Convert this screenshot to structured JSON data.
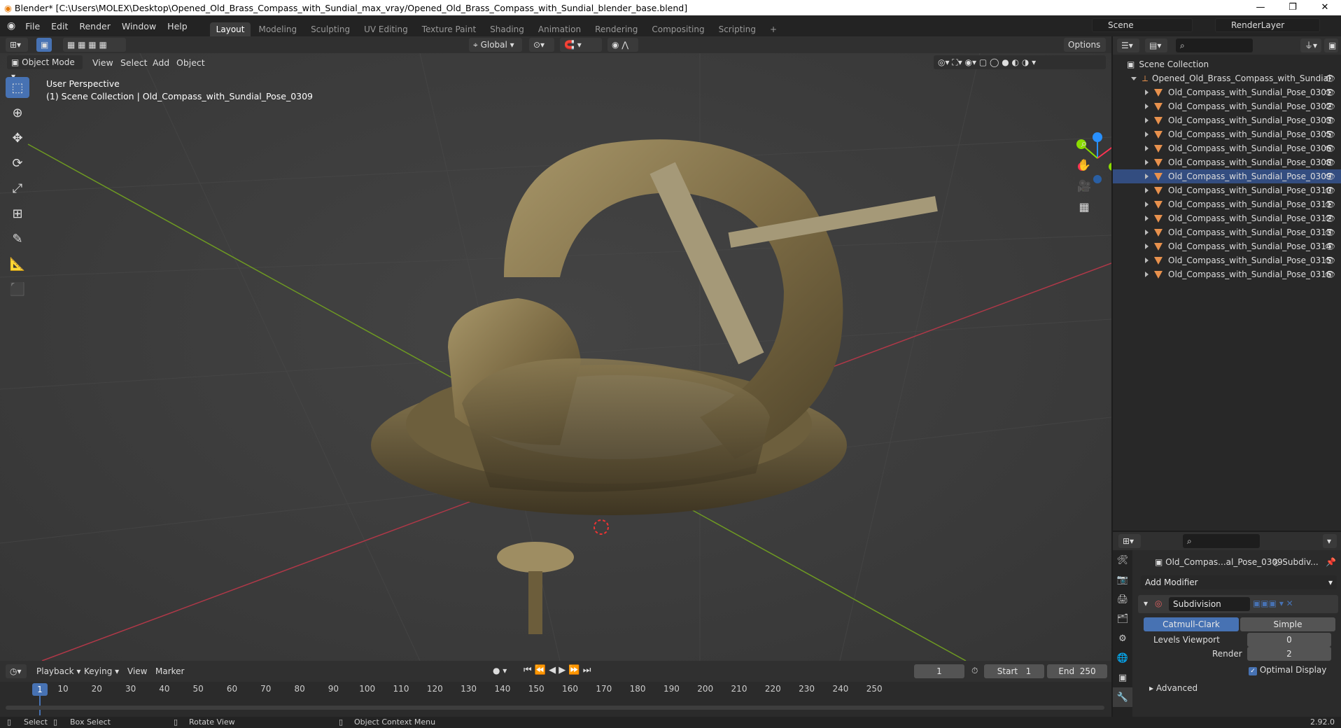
{
  "window": {
    "title": "Blender* [C:\\Users\\MOLEX\\Desktop\\Opened_Old_Brass_Compass_with_Sundial_max_vray/Opened_Old_Brass_Compass_with_Sundial_blender_base.blend]",
    "controls": [
      "—",
      "❐",
      "✕"
    ]
  },
  "menubar": {
    "items": [
      "File",
      "Edit",
      "Render",
      "Window",
      "Help"
    ],
    "workspaces": [
      "Layout",
      "Modeling",
      "Sculpting",
      "UV Editing",
      "Texture Paint",
      "Shading",
      "Animation",
      "Rendering",
      "Compositing",
      "Scripting"
    ],
    "active_workspace": "Layout",
    "add_tab": "+",
    "scene": "Scene",
    "render_layer": "RenderLayer"
  },
  "viewport_header": {
    "orientation": "Global",
    "options": "Options",
    "mode": "Object Mode",
    "menus": [
      "View",
      "Select",
      "Add",
      "Object"
    ]
  },
  "viewport": {
    "perspective": "User Perspective",
    "collection_info": "(1) Scene Collection | Old_Compass_with_Sundial_Pose_0309",
    "gizmo": {
      "z": "Z",
      "y": "Y",
      "x": "X"
    }
  },
  "tools": [
    "select-box",
    "cursor",
    "move",
    "rotate",
    "scale",
    "transform",
    "annotate",
    "measure",
    "add-cube"
  ],
  "outliner": {
    "root": "Scene Collection",
    "collection": "Opened_Old_Brass_Compass_with_Sundial",
    "objects": [
      "Old_Compass_with_Sundial_Pose_0301",
      "Old_Compass_with_Sundial_Pose_0302",
      "Old_Compass_with_Sundial_Pose_0303",
      "Old_Compass_with_Sundial_Pose_0305",
      "Old_Compass_with_Sundial_Pose_0306",
      "Old_Compass_with_Sundial_Pose_0308",
      "Old_Compass_with_Sundial_Pose_0309",
      "Old_Compass_with_Sundial_Pose_0310",
      "Old_Compass_with_Sundial_Pose_0311",
      "Old_Compass_with_Sundial_Pose_0312",
      "Old_Compass_with_Sundial_Pose_0313",
      "Old_Compass_with_Sundial_Pose_0314",
      "Old_Compass_with_Sundial_Pose_0315",
      "Old_Compass_with_Sundial_Pose_0316"
    ],
    "selected_index": 6
  },
  "properties": {
    "object_name": "Old_Compas...al_Pose_0309",
    "modifier_short": "Subdiv...",
    "add_modifier": "Add Modifier",
    "modifier_name": "Subdivision",
    "mode_options": [
      "Catmull-Clark",
      "Simple"
    ],
    "active_mode": "Catmull-Clark",
    "levels_viewport_label": "Levels Viewport",
    "levels_viewport": "0",
    "render_label": "Render",
    "render_value": "2",
    "optimal_display_label": "Optimal Display",
    "optimal_display": true,
    "advanced_label": "Advanced"
  },
  "timeline": {
    "menus": [
      "Playback",
      "Keying",
      "View",
      "Marker"
    ],
    "current_frame": "1",
    "start_label": "Start",
    "start": "1",
    "end_label": "End",
    "end": "250",
    "ticks": [
      "10",
      "20",
      "30",
      "40",
      "50",
      "60",
      "70",
      "80",
      "90",
      "100",
      "110",
      "120",
      "130",
      "140",
      "150",
      "160",
      "170",
      "180",
      "190",
      "200",
      "210",
      "220",
      "230",
      "240",
      "250"
    ],
    "playhead": "1"
  },
  "statusbar": {
    "items": [
      "Select",
      "Box Select",
      "Rotate View",
      "Object Context Menu"
    ],
    "version": "2.92.0"
  },
  "colors": {
    "accent": "#4772b3",
    "selected_row": "#334d80",
    "mesh_icon": "#e8914d",
    "axis_x": "#ff3352",
    "axis_y": "#8bdc00",
    "axis_z": "#2890ff"
  }
}
